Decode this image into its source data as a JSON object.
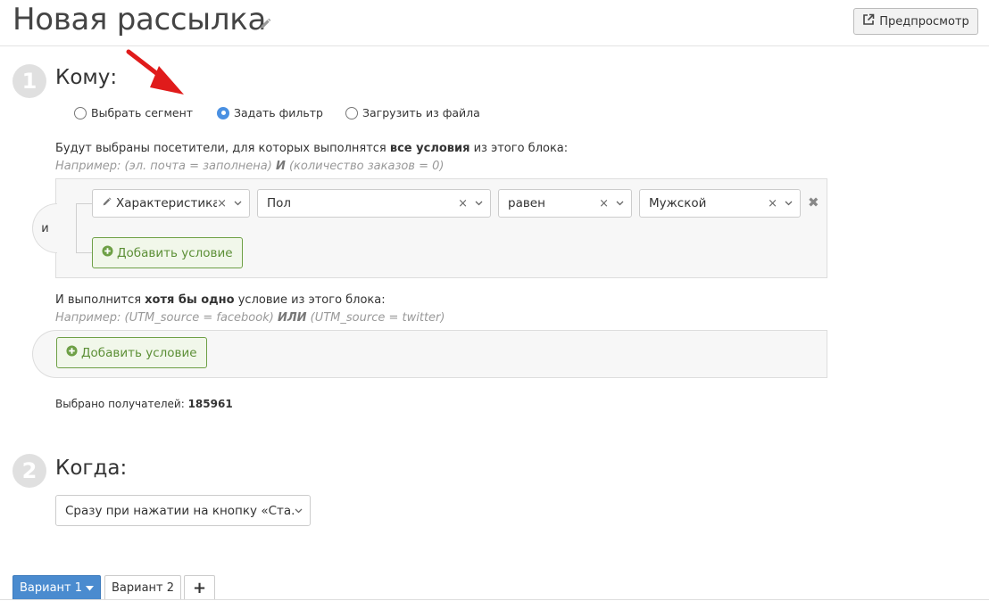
{
  "header": {
    "title": "Новая рассылка",
    "preview_label": "Предпросмотр"
  },
  "step1": {
    "number": "1",
    "title": "Кому:",
    "radios": [
      {
        "label": "Выбрать сегмент",
        "selected": false
      },
      {
        "label": "Задать фильтр",
        "selected": true
      },
      {
        "label": "Загрузить из файла",
        "selected": false
      }
    ],
    "all_block": {
      "desc_pre": "Будут выбраны посетители, для которых выполнятся ",
      "desc_bold": "все условия",
      "desc_post": " из этого блока:",
      "hint_pre": "Например: (эл. почта = заполнена) ",
      "hint_bold": "И",
      "hint_post": " (количество заказов = 0)",
      "connector": "и",
      "condition": {
        "field_type": "Характеристика",
        "field": "Пол",
        "operator": "равен",
        "value": "Мужской",
        "clear_symbol": "×",
        "remove_symbol": "✖"
      },
      "add_label": "Добавить условие"
    },
    "any_block": {
      "desc_pre": "И выполнится ",
      "desc_bold": "хотя бы одно",
      "desc_post": " условие из этого блока:",
      "hint_pre": "Например: (UTM_source = facebook) ",
      "hint_bold": "ИЛИ",
      "hint_post": " (UTM_source = twitter)",
      "add_label": "Добавить условие"
    },
    "recipients_label": "Выбрано получателей: ",
    "recipients_count": "185961"
  },
  "step2": {
    "number": "2",
    "title": "Когда:",
    "schedule_value": "Сразу при нажатии на кнопку «Ста..."
  },
  "tabs": [
    {
      "label": "Вариант 1",
      "active": true
    },
    {
      "label": "Вариант 2",
      "active": false
    },
    {
      "label": "+",
      "active": false
    }
  ],
  "colors": {
    "accent": "#4a90e2",
    "success": "#5c8f36",
    "arrow": "#e01b1b",
    "tab_active": "#4a8bcf"
  }
}
